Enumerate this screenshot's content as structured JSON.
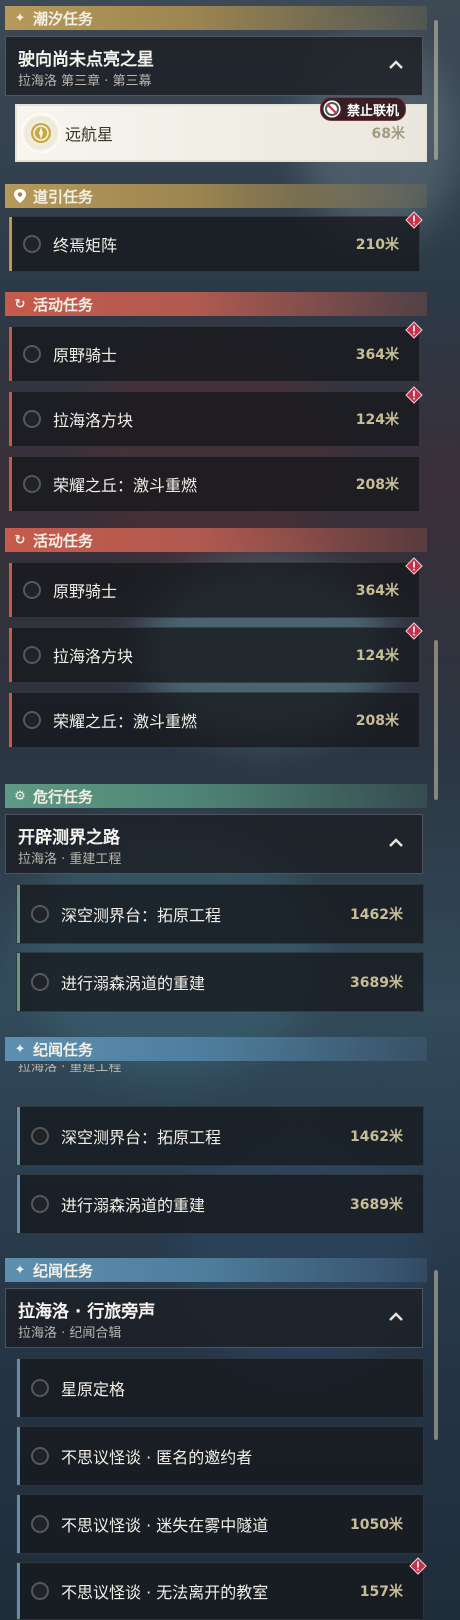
{
  "sections": {
    "tide": {
      "title": "潮汐任务",
      "icon": "sparkle-icon"
    },
    "guide": {
      "title": "道引任务",
      "icon": "map-pin-icon"
    },
    "activity1": {
      "title": "活动任务",
      "icon": "swirl-icon"
    },
    "activity2": {
      "title": "活动任务",
      "icon": "swirl-icon"
    },
    "danger": {
      "title": "危行任务",
      "icon": "gear-icon"
    },
    "lore1": {
      "title": "纪闻任务",
      "icon": "sparkle-icon"
    },
    "lore2": {
      "title": "纪闻任务",
      "icon": "sparkle-icon"
    }
  },
  "groups": {
    "star": {
      "title": "驶向尚未点亮之星",
      "subtitle": "拉海洛 第三章 · 第三幕"
    },
    "survey": {
      "title": "开辟测界之路",
      "subtitle": "拉海洛 · 重建工程",
      "cut_subtitle": "拉海洛 · 重建工程"
    },
    "voices": {
      "title": "拉海洛 · 行旅旁声",
      "subtitle": "拉海洛 · 纪闻合辑"
    }
  },
  "badge": {
    "offline_label": "禁止联机"
  },
  "quests": {
    "voyager": {
      "name": "远航星",
      "dist": "68米"
    },
    "matrix": {
      "name": "终焉矩阵",
      "dist": "210米"
    },
    "a_knight": {
      "name": "原野骑士",
      "dist": "364米"
    },
    "a_cube": {
      "name": "拉海洛方块",
      "dist": "124米"
    },
    "a_hill": {
      "name": "荣耀之丘：激斗重燃",
      "dist": "208米"
    },
    "b_knight": {
      "name": "原野骑士",
      "dist": "364米"
    },
    "b_cube": {
      "name": "拉海洛方块",
      "dist": "124米"
    },
    "b_hill": {
      "name": "荣耀之丘：激斗重燃",
      "dist": "208米"
    },
    "s_deep": {
      "name": "深空测界台：拓原工程",
      "dist": "1462米"
    },
    "s_vortex": {
      "name": "进行溺森涡道的重建",
      "dist": "3689米"
    },
    "s_deep2": {
      "name": "深空测界台：拓原工程",
      "dist": "1462米"
    },
    "s_vortex2": {
      "name": "进行溺森涡道的重建",
      "dist": "3689米"
    },
    "v_star": {
      "name": "星原定格",
      "dist": ""
    },
    "v_invite": {
      "name": "不思议怪谈 · 匿名的邀约者",
      "dist": ""
    },
    "v_tunnel": {
      "name": "不思议怪谈 · 迷失在雾中隧道",
      "dist": "1050米"
    },
    "v_class": {
      "name": "不思议怪谈 · 无法离开的教室",
      "dist": "157米"
    }
  },
  "colors": {
    "gold": "#b79a5a",
    "red": "#c65a4c",
    "teal": "#5f9a86",
    "blue": "#5d8fb0",
    "warn": "#c4314b"
  }
}
